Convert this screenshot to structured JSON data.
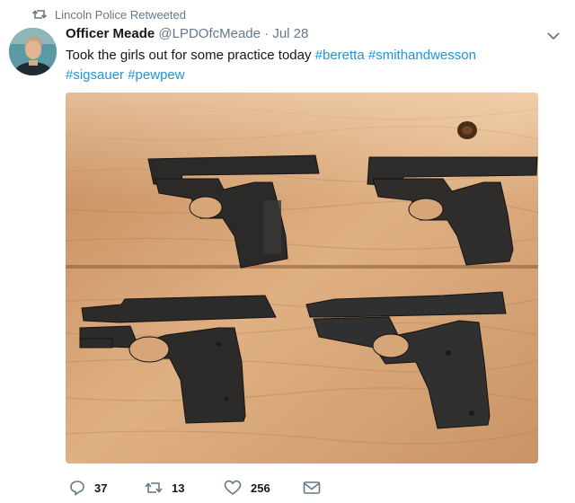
{
  "retweet": {
    "icon": "retweet-icon",
    "text": "Lincoln Police Retweeted"
  },
  "tweet": {
    "author_name": "Officer Meade",
    "handle": "@LPDOfcMeade",
    "separator": "·",
    "date": "Jul 28",
    "text_plain": "Took the girls out for some practice today ",
    "hashtags": [
      "#beretta",
      "#smithandwesson",
      "#sigsauer",
      "#pewpew"
    ]
  },
  "actions": {
    "reply_count": "37",
    "retweet_count": "13",
    "like_count": "256"
  },
  "colors": {
    "link": "#1b95e0",
    "secondary": "#657786",
    "wood": "#c99466"
  },
  "icons": [
    "retweet-icon",
    "chevron-down-icon",
    "reply-icon",
    "retweet-icon",
    "heart-icon",
    "envelope-icon"
  ]
}
